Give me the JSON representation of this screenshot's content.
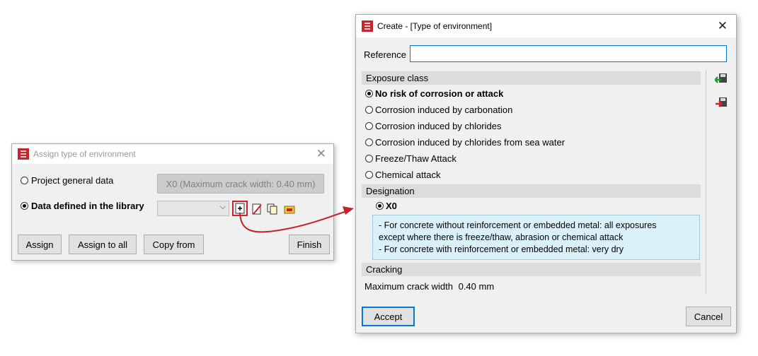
{
  "assign_dialog": {
    "title": "Assign type of environment",
    "radio_project": "Project general data",
    "radio_library": "Data defined in the library",
    "project_value": "X0 (Maximum crack width: 0.40 mm)",
    "library_value": "",
    "buttons": {
      "assign": "Assign",
      "assign_all": "Assign to all",
      "copy_from": "Copy from",
      "finish": "Finish"
    }
  },
  "create_dialog": {
    "title": "Create - [Type of environment]",
    "reference_label": "Reference",
    "reference_value": "",
    "exposure_header": "Exposure class",
    "exposure_options": [
      "No risk of corrosion or attack",
      "Corrosion induced by carbonation",
      "Corrosion induced by chlorides",
      "Corrosion induced by chlorides from sea water",
      "Freeze/Thaw Attack",
      "Chemical attack"
    ],
    "designation_header": "Designation",
    "designation_value": "X0",
    "designation_description": [
      "- For concrete without reinforcement or embedded metal: all exposures",
      "except where there is freeze/thaw, abrasion or chemical attack",
      "- For concrete with reinforcement or embedded metal: very dry"
    ],
    "cracking_header": "Cracking",
    "crack_label": "Maximum crack width",
    "crack_value": "0.40 mm",
    "accept": "Accept",
    "cancel": "Cancel"
  },
  "colors": {
    "accent": "#0078d7",
    "highlight": "#d0202a",
    "info_bg": "#dbf1f9"
  }
}
